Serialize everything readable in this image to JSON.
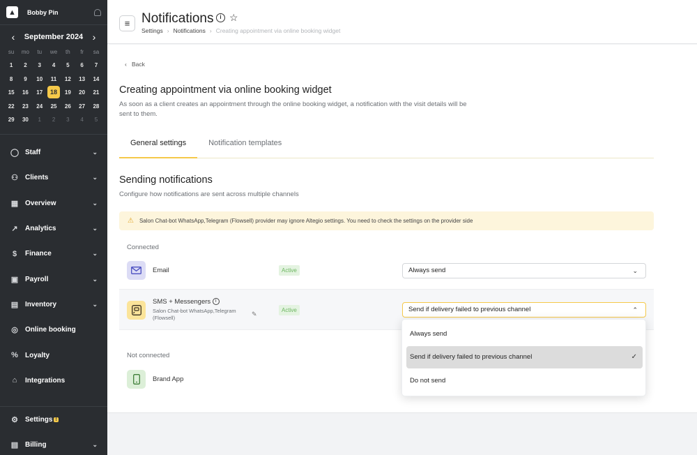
{
  "sidebar": {
    "user_name": "Bobby Pin",
    "calendar": {
      "title": "September 2024",
      "dow": [
        "su",
        "mo",
        "tu",
        "we",
        "th",
        "fr",
        "sa"
      ],
      "weeks": [
        [
          "1",
          "2",
          "3",
          "4",
          "5",
          "6",
          "7"
        ],
        [
          "8",
          "9",
          "10",
          "11",
          "12",
          "13",
          "14"
        ],
        [
          "15",
          "16",
          "17",
          "18",
          "19",
          "20",
          "21"
        ],
        [
          "22",
          "23",
          "24",
          "25",
          "26",
          "27",
          "28"
        ],
        [
          "29",
          "30",
          "1",
          "2",
          "3",
          "4",
          "5"
        ]
      ],
      "today": "18"
    },
    "nav": [
      {
        "label": "Staff",
        "icon": "person-icon",
        "chevron": true
      },
      {
        "label": "Clients",
        "icon": "people-icon",
        "chevron": true
      },
      {
        "label": "Overview",
        "icon": "grid-icon",
        "chevron": true
      },
      {
        "label": "Analytics",
        "icon": "chart-icon",
        "chevron": true
      },
      {
        "label": "Finance",
        "icon": "dollar-icon",
        "chevron": true
      },
      {
        "label": "Payroll",
        "icon": "wallet-icon",
        "chevron": true
      },
      {
        "label": "Inventory",
        "icon": "box-icon",
        "chevron": true
      },
      {
        "label": "Online booking",
        "icon": "globe-icon",
        "chevron": false
      },
      {
        "label": "Loyalty",
        "icon": "percent-icon",
        "chevron": false
      },
      {
        "label": "Integrations",
        "icon": "building-icon",
        "chevron": false
      }
    ],
    "bottom": [
      {
        "label": "Settings",
        "icon": "gear-icon",
        "badge": "!",
        "chevron": false
      },
      {
        "label": "Billing",
        "icon": "billing-icon",
        "chevron": true
      }
    ]
  },
  "header": {
    "title": "Notifications",
    "breadcrumbs": [
      "Settings",
      "Notifications",
      "Creating appointment via online booking widget"
    ]
  },
  "content": {
    "back_label": "Back",
    "heading": "Creating appointment via online booking widget",
    "description": "As soon as a client creates an appointment through the online booking widget, a notification with the visit details will be sent to them.",
    "tabs": [
      "General settings",
      "Notification templates"
    ],
    "section_title": "Sending notifications",
    "section_sub": "Configure how notifications are sent across multiple channels",
    "warning": "Salon Chat-bot WhatsApp,Telegram (Flowsell) provider may ignore Altegio settings. You need to check the settings on the provider side",
    "connected_label": "Connected",
    "not_connected_label": "Not connected",
    "channels": {
      "email": {
        "name": "Email",
        "status": "Active",
        "value": "Always send"
      },
      "sms": {
        "name": "SMS + Messengers",
        "sub": "Salon Chat-bot WhatsApp,Telegram (Flowsell)",
        "status": "Active",
        "value": "Send if delivery failed to previous channel"
      },
      "app": {
        "name": "Brand App"
      }
    },
    "dropdown_options": [
      "Always send",
      "Send if delivery failed to previous channel",
      "Do not send"
    ],
    "selected_option": "Send if delivery failed to previous channel"
  },
  "colors": {
    "sidebar_bg": "#2a2d31",
    "accent": "#f5c94a",
    "active_green": "#6cb660"
  }
}
